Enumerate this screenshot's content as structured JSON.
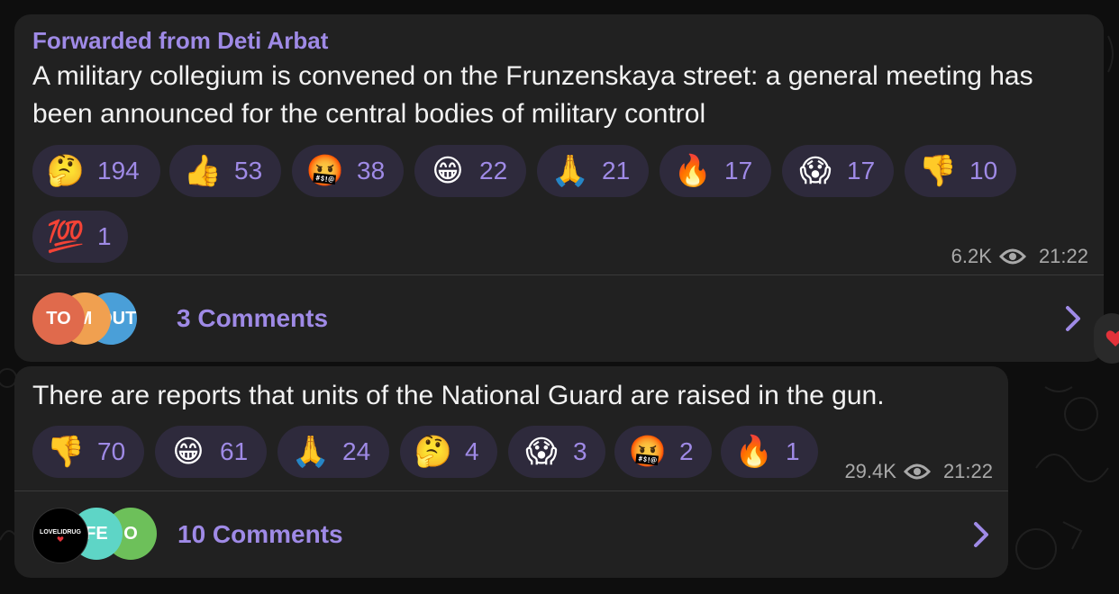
{
  "colors": {
    "accent": "#9f8ae6",
    "bubble": "#212121",
    "reaction_bg": "#2e2a3c",
    "meta": "#a9a9a9",
    "background": "#0e0e0e"
  },
  "messages": [
    {
      "forwarded_from": "Forwarded from Deti Arbat",
      "text": "A military collegium is convened on the Frunzenskaya street: a general meeting has been announced for the central bodies of military control",
      "reactions": [
        {
          "emoji": "🤔",
          "icon": "thinking-face-icon",
          "count": "194"
        },
        {
          "emoji": "👍",
          "icon": "thumbs-up-icon",
          "count": "53"
        },
        {
          "emoji": "🤬",
          "icon": "cursing-face-icon",
          "count": "38"
        },
        {
          "emoji": "😁",
          "icon": "grinning-face-icon",
          "count": "22"
        },
        {
          "emoji": "🙏",
          "icon": "folded-hands-icon",
          "count": "21"
        },
        {
          "emoji": "🔥",
          "icon": "fire-icon",
          "count": "17"
        },
        {
          "emoji": "😱",
          "icon": "screaming-face-icon",
          "count": "17"
        },
        {
          "emoji": "👎",
          "icon": "thumbs-down-icon",
          "count": "10"
        },
        {
          "emoji": "💯",
          "icon": "hundred-points-icon",
          "count": "1"
        }
      ],
      "views": "6.2K",
      "time": "21:22",
      "comments": {
        "avatars": [
          "TO",
          "M",
          "BOUT"
        ],
        "label": "3 Comments"
      }
    },
    {
      "text": "There are reports that units of the National Guard are raised in the gun.",
      "reactions": [
        {
          "emoji": "👎",
          "icon": "thumbs-down-icon",
          "count": "70"
        },
        {
          "emoji": "😁",
          "icon": "grinning-face-icon",
          "count": "61"
        },
        {
          "emoji": "🙏",
          "icon": "folded-hands-icon",
          "count": "24"
        },
        {
          "emoji": "🤔",
          "icon": "thinking-face-icon",
          "count": "4"
        },
        {
          "emoji": "😱",
          "icon": "screaming-face-icon",
          "count": "3"
        },
        {
          "emoji": "🤬",
          "icon": "cursing-face-icon",
          "count": "2"
        },
        {
          "emoji": "🔥",
          "icon": "fire-icon",
          "count": "1"
        }
      ],
      "views": "29.4K",
      "time": "21:22",
      "comments": {
        "avatars": [
          "LOVELIDRUG",
          "FE",
          "O"
        ],
        "label": "10 Comments"
      }
    }
  ]
}
